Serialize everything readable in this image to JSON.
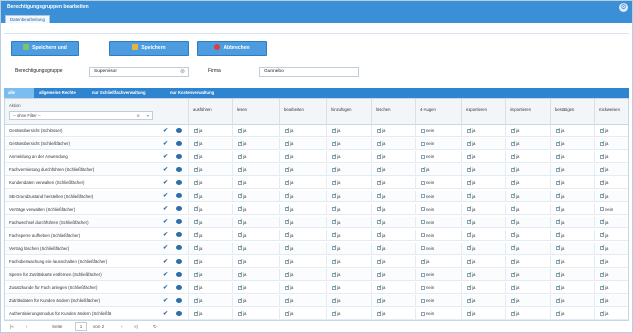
{
  "window": {
    "title": "Berechtigungsgruppen bearbeiten",
    "tab": "Datenbearbeitung"
  },
  "toolbar": {
    "save_close_label": "Speichern und schließen",
    "save_label": "Speichern",
    "cancel_label": "Abbrechen"
  },
  "form": {
    "group_label": "Berechtigungsgruppe",
    "group_value": "Supervisor",
    "company_label": "Firma",
    "company_value": "Gunnebo"
  },
  "subtabs": [
    "alle Rechte",
    "allgemeine Rechte",
    "nur Schließfachverwaltung",
    "nur Kostenverwaltung"
  ],
  "grid": {
    "aktion_header": "Aktion",
    "filter_value": "-- ohne Filter --",
    "columns": [
      "ausführen",
      "lesen",
      "bearbeiten",
      "hinzufügen",
      "löschen",
      "4-Augen",
      "exportieren",
      "importieren",
      "bestätigen",
      "rückweisen"
    ],
    "rows": [
      {
        "name": "Geräteübersicht (Schlösser)",
        "cells": [
          "ja",
          "ja",
          "ja",
          "ja",
          "ja",
          "nein",
          "ja",
          "ja",
          "ja",
          "ja"
        ]
      },
      {
        "name": "Geräteübersicht (Schließfächer)",
        "cells": [
          "ja",
          "ja",
          "ja",
          "ja",
          "ja",
          "nein",
          "ja",
          "ja",
          "ja",
          "ja"
        ]
      },
      {
        "name": "Anmeldung an der Anwendung",
        "cells": [
          "ja",
          "ja",
          "ja",
          "ja",
          "ja",
          "nein",
          "ja",
          "ja",
          "ja",
          "ja"
        ]
      },
      {
        "name": "Fachvermietung durchführen (Schließfächer)",
        "cells": [
          "ja",
          "ja",
          "ja",
          "ja",
          "ja",
          "ja",
          "ja",
          "ja",
          "ja",
          "ja"
        ]
      },
      {
        "name": "Kundendaten verwalten (Schließfächer)",
        "cells": [
          "ja",
          "ja",
          "ja",
          "ja",
          "ja",
          "nein",
          "ja",
          "ja",
          "ja",
          "ja"
        ]
      },
      {
        "name": "SB-Grundzustand herstellen (Schließfächer)",
        "cells": [
          "ja",
          "ja",
          "ja",
          "ja",
          "ja",
          "nein",
          "ja",
          "ja",
          "ja",
          "ja"
        ]
      },
      {
        "name": "Verträge verwalten (Schließfächer)",
        "cells": [
          "ja",
          "ja",
          "ja",
          "ja",
          "ja",
          "nein",
          "ja",
          "ja",
          "ja",
          "nein"
        ]
      },
      {
        "name": "Fachwechsel durchführen (Schließfächer)",
        "cells": [
          "ja",
          "ja",
          "ja",
          "ja",
          "ja",
          "nein",
          "ja",
          "ja",
          "ja",
          "ja"
        ]
      },
      {
        "name": "Fachsperre aufheben (Schließfächer)",
        "cells": [
          "ja",
          "ja",
          "ja",
          "ja",
          "ja",
          "nein",
          "ja",
          "ja",
          "ja",
          "ja"
        ]
      },
      {
        "name": "Vertrag löschen (Schließfächer)",
        "cells": [
          "ja",
          "ja",
          "ja",
          "ja",
          "ja",
          "nein",
          "ja",
          "ja",
          "ja",
          "ja"
        ]
      },
      {
        "name": "Fachüberwachung ein-/ausschalten (Schließfächer)",
        "cells": [
          "ja",
          "ja",
          "ja",
          "ja",
          "ja",
          "ja",
          "ja",
          "ja",
          "ja",
          "ja"
        ]
      },
      {
        "name": "Sperre für Zutrittskarte entfernen (Schließfächer)",
        "cells": [
          "ja",
          "ja",
          "ja",
          "ja",
          "ja",
          "nein",
          "ja",
          "ja",
          "ja",
          "ja"
        ]
      },
      {
        "name": "Zusatzkunde für Fach anlegen (Schließfächer)",
        "cells": [
          "ja",
          "ja",
          "ja",
          "ja",
          "ja",
          "nein",
          "ja",
          "ja",
          "ja",
          "ja"
        ]
      },
      {
        "name": "Zutrittsdaten für Kunden ändern (Schließfächer)",
        "cells": [
          "ja",
          "ja",
          "ja",
          "ja",
          "ja",
          "nein",
          "ja",
          "ja",
          "ja",
          "ja"
        ]
      },
      {
        "name": "Authentisierungsmodus für Kunden ändern (Schließfä",
        "cells": [
          "ja",
          "ja",
          "ja",
          "ja",
          "ja",
          "nein",
          "ja",
          "ja",
          "ja",
          "ja"
        ]
      }
    ]
  },
  "pager": {
    "page_label": "Seite",
    "page_value": "1",
    "of_label": "von 2"
  }
}
